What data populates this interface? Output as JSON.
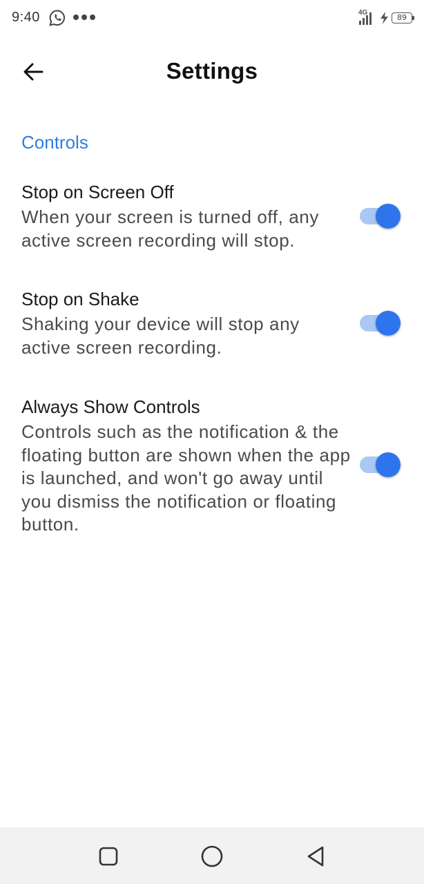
{
  "status_bar": {
    "time": "9:40",
    "network_label": "4G",
    "battery_level": "89",
    "icons": [
      "whatsapp-icon",
      "more-dots-icon",
      "signal-icon",
      "charging-icon",
      "battery-icon"
    ]
  },
  "app_bar": {
    "title": "Settings",
    "back_icon": "arrow-left-icon"
  },
  "section": {
    "title": "Controls"
  },
  "settings": [
    {
      "title": "Stop on Screen Off",
      "description": "When your screen is turned off, any active screen recording will stop.",
      "enabled": true
    },
    {
      "title": "Stop on Shake",
      "description": "Shaking your device will stop any active screen recording.",
      "enabled": true
    },
    {
      "title": "Always Show Controls",
      "description": "Controls such as the notification & the floating button are shown when the app is launched, and won't go away until you dismiss the notification or floating button.",
      "enabled": true
    }
  ],
  "nav_bar": {
    "buttons": [
      "recents-square-icon",
      "home-circle-icon",
      "back-triangle-icon"
    ]
  },
  "colors": {
    "accent": "#2f7de0",
    "toggle_thumb": "#2e74ed",
    "toggle_track": "#a9c8f3",
    "nav_background": "#f2f2f2"
  }
}
